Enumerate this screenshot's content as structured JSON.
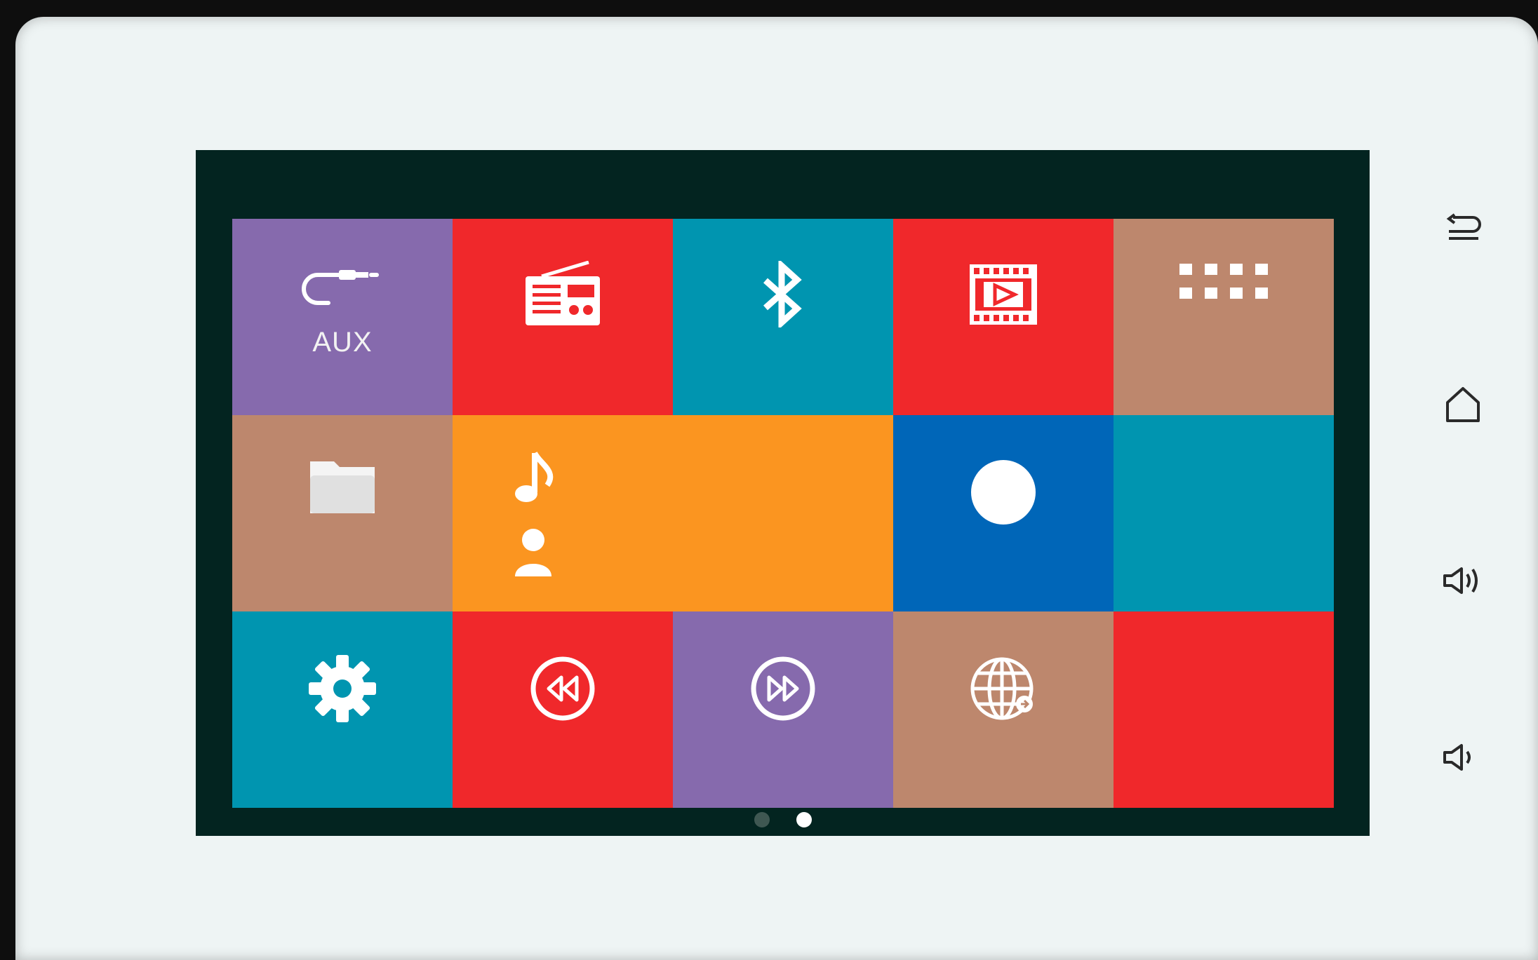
{
  "tiles": [
    {
      "id": "aux",
      "label": "AUX",
      "color": "#866aad",
      "icon": "aux-cable-icon"
    },
    {
      "id": "radio",
      "label": "",
      "color": "#f0282b",
      "icon": "radio-icon"
    },
    {
      "id": "bluetooth",
      "label": "",
      "color": "#0095b0",
      "icon": "bluetooth-icon"
    },
    {
      "id": "video",
      "label": "",
      "color": "#f0282b",
      "icon": "video-icon"
    },
    {
      "id": "apps",
      "label": "",
      "color": "#bd876d",
      "icon": "apps-grid-icon"
    },
    {
      "id": "files",
      "label": "",
      "color": "#bd876d",
      "icon": "folder-icon"
    },
    {
      "id": "music",
      "label": "",
      "color": "#fb9520",
      "icon": "music-note-icon"
    },
    {
      "id": "record",
      "label": "",
      "color": "#0066b8",
      "icon": "circle-icon"
    },
    {
      "id": "blank1",
      "label": "",
      "color": "#0095b0",
      "icon": ""
    },
    {
      "id": "settings",
      "label": "",
      "color": "#0095b0",
      "icon": "gear-icon"
    },
    {
      "id": "rewind",
      "label": "",
      "color": "#f0282b",
      "icon": "rewind-icon"
    },
    {
      "id": "fastforward",
      "label": "",
      "color": "#866aad",
      "icon": "fast-forward-icon"
    },
    {
      "id": "browser",
      "label": "",
      "color": "#bd876d",
      "icon": "globe-icon"
    },
    {
      "id": "blank2",
      "label": "",
      "color": "#f0282b",
      "icon": ""
    }
  ],
  "pager": {
    "pages": 2,
    "active": 2,
    "inactive_color": "#3f5752",
    "active_color": "#ffffff"
  },
  "side_buttons": [
    "back-icon",
    "home-icon",
    "volume-up-icon",
    "volume-down-icon"
  ]
}
